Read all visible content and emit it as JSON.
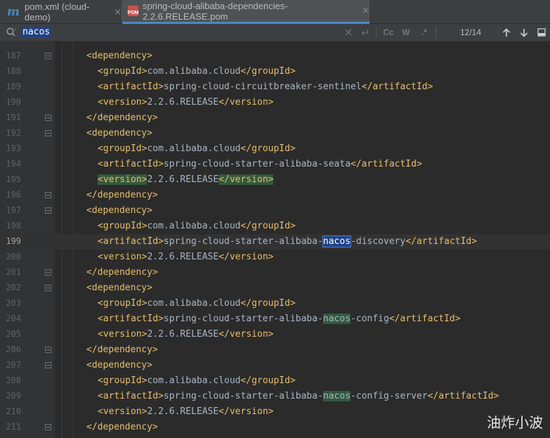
{
  "tabs": [
    {
      "label": "pom.xml (cloud-demo)",
      "icon": "maven-m-icon",
      "active": false
    },
    {
      "label": "spring-cloud-alibaba-dependencies-2.2.6.RELEASE.pom",
      "icon": "pom-file-icon",
      "active": true
    }
  ],
  "tab_close_glyph": "×",
  "search": {
    "query": "nacos",
    "match_case_label": "Cc",
    "words_label": "W",
    "regex_label": ".*",
    "match_count": "12/14"
  },
  "editor": {
    "lines": [
      {
        "num": "187",
        "fold": true,
        "indent": 1,
        "parts": [
          [
            "tag",
            "<dependency>"
          ]
        ]
      },
      {
        "num": "188",
        "fold": false,
        "indent": 2,
        "parts": [
          [
            "tag",
            "<groupId>"
          ],
          [
            "txt",
            "com.alibaba.cloud"
          ],
          [
            "tag",
            "</groupId>"
          ]
        ]
      },
      {
        "num": "189",
        "fold": false,
        "indent": 2,
        "parts": [
          [
            "tag",
            "<artifactId>"
          ],
          [
            "txt",
            "spring-cloud-circuitbreaker-sentinel"
          ],
          [
            "tag",
            "</artifactId>"
          ]
        ]
      },
      {
        "num": "190",
        "fold": false,
        "indent": 2,
        "parts": [
          [
            "tag",
            "<version>"
          ],
          [
            "txt",
            "2.2.6.RELEASE"
          ],
          [
            "tag",
            "</version>"
          ]
        ]
      },
      {
        "num": "191",
        "fold": true,
        "indent": 1,
        "parts": [
          [
            "tag",
            "</dependency>"
          ]
        ]
      },
      {
        "num": "192",
        "fold": true,
        "indent": 1,
        "parts": [
          [
            "tag",
            "<dependency>"
          ]
        ]
      },
      {
        "num": "193",
        "fold": false,
        "indent": 2,
        "parts": [
          [
            "tag",
            "<groupId>"
          ],
          [
            "txt",
            "com.alibaba.cloud"
          ],
          [
            "tag",
            "</groupId>"
          ]
        ]
      },
      {
        "num": "194",
        "fold": false,
        "indent": 2,
        "parts": [
          [
            "tag",
            "<artifactId>"
          ],
          [
            "txt",
            "spring-cloud-starter-alibaba-seata"
          ],
          [
            "tag",
            "</artifactId>"
          ]
        ]
      },
      {
        "num": "195",
        "fold": false,
        "indent": 2,
        "parts": [
          [
            "tag hl-tag",
            "<version>"
          ],
          [
            "txt",
            "2.2.6.RELEASE"
          ],
          [
            "tag hl-tag",
            "</version>"
          ]
        ]
      },
      {
        "num": "196",
        "fold": true,
        "indent": 1,
        "parts": [
          [
            "tag",
            "</dependency>"
          ]
        ]
      },
      {
        "num": "197",
        "fold": true,
        "indent": 1,
        "parts": [
          [
            "tag",
            "<dependency>"
          ]
        ]
      },
      {
        "num": "198",
        "fold": false,
        "indent": 2,
        "parts": [
          [
            "tag",
            "<groupId>"
          ],
          [
            "txt",
            "com.alibaba.cloud"
          ],
          [
            "tag",
            "</groupId>"
          ]
        ]
      },
      {
        "num": "199",
        "fold": false,
        "indent": 2,
        "current": true,
        "parts": [
          [
            "tag",
            "<artifactId>"
          ],
          [
            "txt",
            "spring-cloud-starter-alibaba-"
          ],
          [
            "hl-cur",
            "nacos"
          ],
          [
            "txt",
            "-discovery"
          ],
          [
            "tag",
            "</artifactId>"
          ]
        ]
      },
      {
        "num": "200",
        "fold": false,
        "indent": 2,
        "parts": [
          [
            "tag",
            "<version>"
          ],
          [
            "txt",
            "2.2.6.RELEASE"
          ],
          [
            "tag",
            "</version>"
          ]
        ]
      },
      {
        "num": "201",
        "fold": true,
        "indent": 1,
        "parts": [
          [
            "tag",
            "</dependency>"
          ]
        ]
      },
      {
        "num": "202",
        "fold": true,
        "indent": 1,
        "parts": [
          [
            "tag",
            "<dependency>"
          ]
        ]
      },
      {
        "num": "203",
        "fold": false,
        "indent": 2,
        "parts": [
          [
            "tag",
            "<groupId>"
          ],
          [
            "txt",
            "com.alibaba.cloud"
          ],
          [
            "tag",
            "</groupId>"
          ]
        ]
      },
      {
        "num": "204",
        "fold": false,
        "indent": 2,
        "parts": [
          [
            "tag",
            "<artifactId>"
          ],
          [
            "txt",
            "spring-cloud-starter-alibaba-"
          ],
          [
            "hl-match",
            "nacos"
          ],
          [
            "txt",
            "-config"
          ],
          [
            "tag",
            "</artifactId>"
          ]
        ]
      },
      {
        "num": "205",
        "fold": false,
        "indent": 2,
        "parts": [
          [
            "tag",
            "<version>"
          ],
          [
            "txt",
            "2.2.6.RELEASE"
          ],
          [
            "tag",
            "</version>"
          ]
        ]
      },
      {
        "num": "206",
        "fold": true,
        "indent": 1,
        "parts": [
          [
            "tag",
            "</dependency>"
          ]
        ]
      },
      {
        "num": "207",
        "fold": true,
        "indent": 1,
        "parts": [
          [
            "tag",
            "<dependency>"
          ]
        ]
      },
      {
        "num": "208",
        "fold": false,
        "indent": 2,
        "parts": [
          [
            "tag",
            "<groupId>"
          ],
          [
            "txt",
            "com.alibaba.cloud"
          ],
          [
            "tag",
            "</groupId>"
          ]
        ]
      },
      {
        "num": "209",
        "fold": false,
        "indent": 2,
        "parts": [
          [
            "tag",
            "<artifactId>"
          ],
          [
            "txt",
            "spring-cloud-starter-alibaba-"
          ],
          [
            "hl-match",
            "nacos"
          ],
          [
            "txt",
            "-config-server"
          ],
          [
            "tag",
            "</artifactId>"
          ]
        ]
      },
      {
        "num": "210",
        "fold": false,
        "indent": 2,
        "parts": [
          [
            "tag",
            "<version>"
          ],
          [
            "txt",
            "2.2.6.RELEASE"
          ],
          [
            "tag",
            "</version>"
          ]
        ]
      },
      {
        "num": "211",
        "fold": true,
        "indent": 1,
        "parts": [
          [
            "tag",
            "</dependency>"
          ]
        ]
      }
    ]
  },
  "watermark": "油炸小波",
  "colors": {
    "tag": "#e8bf6a",
    "text": "#a9b7c6",
    "match": "#32593d",
    "current_match": "#214283",
    "background": "#2b2b2b"
  }
}
